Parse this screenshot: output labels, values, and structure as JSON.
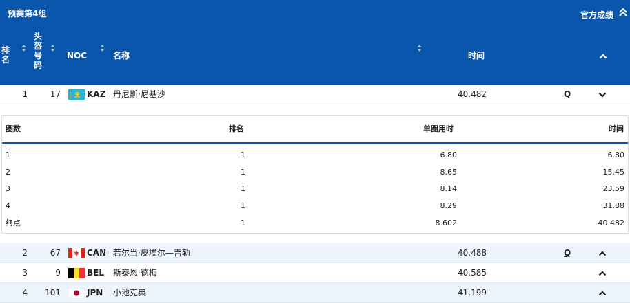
{
  "header": {
    "group_title": "预赛第4组",
    "official_results": "官方成绩",
    "col_rank": "排名",
    "col_bib": "头盔号码",
    "col_noc": "NOC",
    "col_name": "名称",
    "col_time": "时间"
  },
  "rows": [
    {
      "rank": "1",
      "bib": "17",
      "noc": "KAZ",
      "name": "丹尼斯·尼基沙",
      "time": "40.482",
      "qual": "Q",
      "expanded": true
    },
    {
      "rank": "2",
      "bib": "67",
      "noc": "CAN",
      "name": "若尔当·皮埃尔—吉勒",
      "time": "40.488",
      "qual": "Q",
      "expanded": false
    },
    {
      "rank": "3",
      "bib": "9",
      "noc": "BEL",
      "name": "斯泰恩·德梅",
      "time": "40.585",
      "qual": "",
      "expanded": false
    },
    {
      "rank": "4",
      "bib": "101",
      "noc": "JPN",
      "name": "小池克典",
      "time": "41.199",
      "qual": "",
      "expanded": false
    }
  ],
  "laps": {
    "headers": {
      "lap": "圈数",
      "rank": "排名",
      "lap_time": "单圈用时",
      "time": "时间"
    },
    "rows": [
      {
        "lap": "1",
        "rank": "1",
        "lap_time": "6.80",
        "time": "6.80"
      },
      {
        "lap": "2",
        "rank": "1",
        "lap_time": "8.65",
        "time": "15.45"
      },
      {
        "lap": "3",
        "rank": "1",
        "lap_time": "8.14",
        "time": "23.59"
      },
      {
        "lap": "4",
        "rank": "1",
        "lap_time": "8.29",
        "time": "31.88"
      },
      {
        "lap": "终点",
        "rank": "1",
        "lap_time": "8.602",
        "time": "40.482"
      }
    ]
  },
  "colors": {
    "header_bg": "#0b56ad",
    "row_alt_bg": "#eef4fc"
  },
  "icons": [
    "sort-icon",
    "chevron-up-icon",
    "chevron-down-icon",
    "kazakhstan-flag-icon",
    "canada-flag-icon",
    "belgium-flag-icon",
    "japan-flag-icon"
  ]
}
